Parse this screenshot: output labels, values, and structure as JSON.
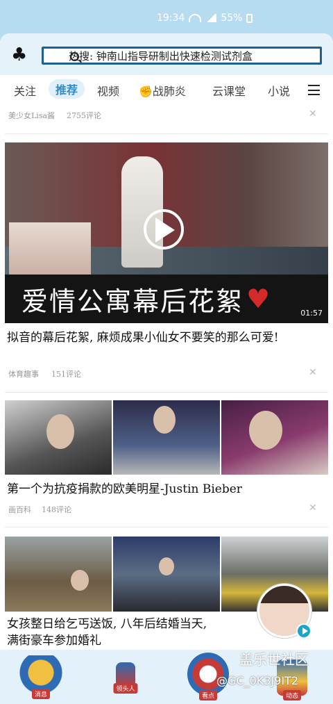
{
  "status_bar": {
    "time": "19:34",
    "battery": "55%"
  },
  "header": {
    "search_placeholder": "热搜: 钟南山指导研制出快速检测试剂盒"
  },
  "tabs": [
    {
      "label": "关注"
    },
    {
      "label": "推荐",
      "active": true
    },
    {
      "label": "视频"
    },
    {
      "label": "战肺炎",
      "icon": "fist-icon"
    },
    {
      "label": "云课堂"
    },
    {
      "label": "小说"
    }
  ],
  "feed": {
    "item0": {
      "source": "美少女Lisa酱",
      "comments": "2755评论"
    },
    "item1": {
      "caption": "爱情公寓幕后花絮",
      "duration": "01:57",
      "title": "拟音的幕后花絮, 麻烦成果小仙女不要笑的那么可爱!",
      "source": "体育趣事",
      "comments": "151评论"
    },
    "item2": {
      "title": "第一个为抗疫捐款的欧美明星-Justin Bieber",
      "source": "画百科",
      "comments": "148评论"
    },
    "item3": {
      "title_line1": "女孩整日给乞丐送饭, 八年后结婚当天,",
      "title_line2": "满街豪车参加婚礼"
    }
  },
  "bottom_nav": {
    "items": [
      {
        "label": "消息"
      },
      {
        "label": "领头人"
      },
      {
        "label": "看点"
      },
      {
        "label": "动态"
      }
    ],
    "watermark": "盖乐世社区",
    "watermark_id": "@GC_0K3J9IT2"
  },
  "colors": {
    "accent": "#2e8bc7",
    "search_border": "#1f5f8e",
    "badge_red": "#c63b37"
  }
}
